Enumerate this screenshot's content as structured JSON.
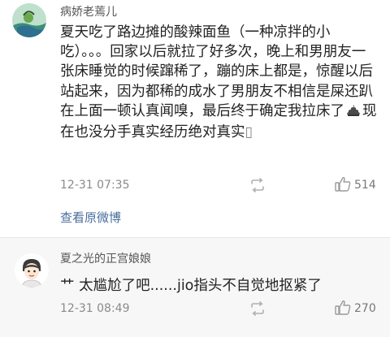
{
  "comments": [
    {
      "username": "病娇老蔫儿",
      "text_before": "夏天吃了路边摊的酸辣面鱼（一种凉拌的小吃）。。。回家以后就拉了好多次，晚上和男朋友一张床睡觉的时候蹿稀了，蹦的床上都是，惊醒以后站起来，因为都稀的成水了男朋友不相信是屎还趴在上面一顿认真闻嗅，最后终于确定我拉床了",
      "emoji_icon": "poop-icon",
      "text_after": "现在也没分手真实经历绝对真实",
      "trailing_glyph": "▯",
      "time": "12-31 07:35",
      "like_count": "514",
      "view_link": "查看原微博"
    },
    {
      "username": "夏之光的正宫娘娘",
      "emoticon": "艹",
      "text": "太尴尬了吧......jio指头不自觉地抠紧了",
      "time": "12-31 08:49",
      "like_count": "270"
    }
  ],
  "colors": {
    "link": "#4a6e9c",
    "meta": "#8a8a8a",
    "second_comment_bg": "#f7f7f7"
  }
}
